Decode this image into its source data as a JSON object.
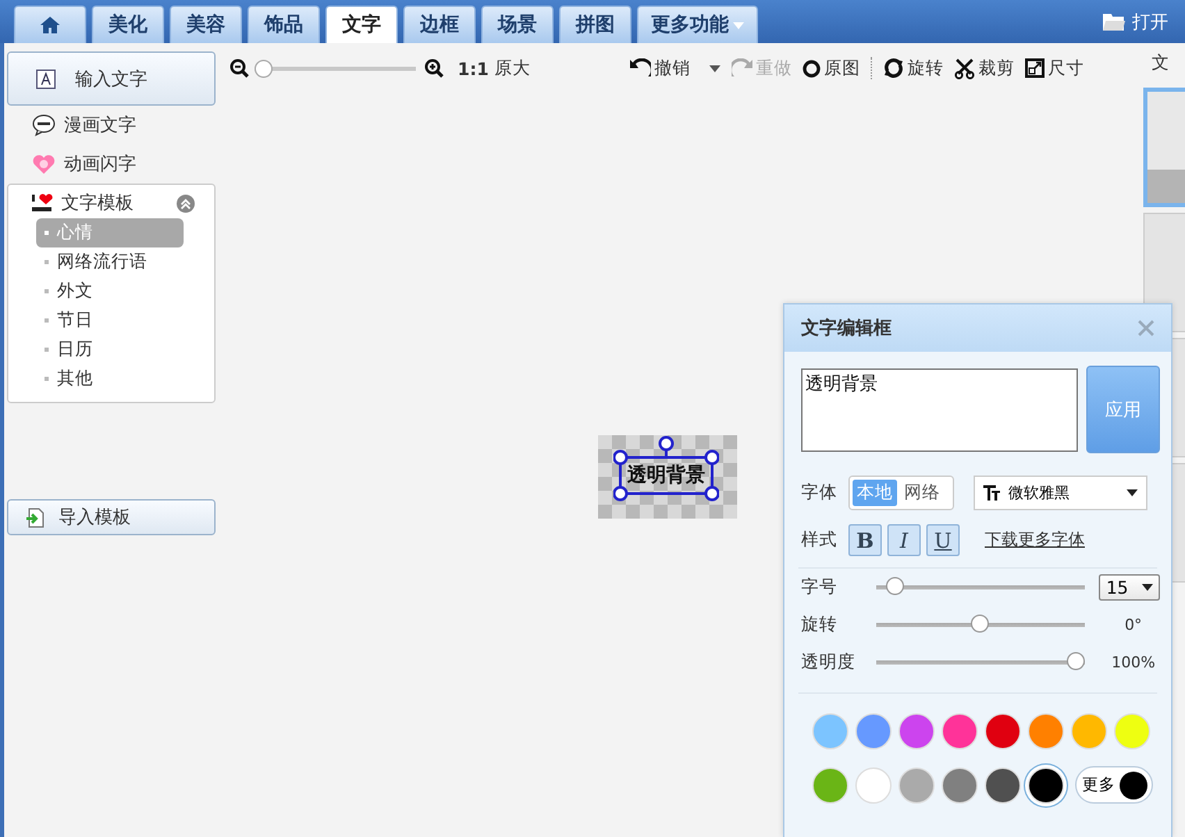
{
  "tabs": [
    {
      "kind": "home",
      "selected": false
    },
    {
      "kind": "tab",
      "label": "美化",
      "selected": false
    },
    {
      "kind": "tab",
      "label": "美容",
      "selected": false
    },
    {
      "kind": "tab",
      "label": "饰品",
      "selected": false
    },
    {
      "kind": "tab",
      "label": "文字",
      "selected": true
    },
    {
      "kind": "tab",
      "label": "边框",
      "selected": false
    },
    {
      "kind": "tab",
      "label": "场景",
      "selected": false
    },
    {
      "kind": "tab",
      "label": "拼图",
      "selected": false
    },
    {
      "kind": "menu",
      "label": "更多功能",
      "selected": false
    }
  ],
  "open_button": "打开",
  "sidebar": {
    "input_button": "输入文字",
    "items": [
      {
        "kind": "comic",
        "label": "漫画文字"
      },
      {
        "kind": "flash",
        "label": "动画闪字"
      }
    ],
    "template_section": {
      "title": "文字模板",
      "expanded": true,
      "items": [
        {
          "label": "心情",
          "selected": true
        },
        {
          "label": "网络流行语",
          "selected": false
        },
        {
          "label": "外文",
          "selected": false
        },
        {
          "label": "节日",
          "selected": false
        },
        {
          "label": "日历",
          "selected": false
        },
        {
          "label": "其他",
          "selected": false
        }
      ]
    },
    "import_button": "导入模板"
  },
  "toolbar": {
    "zoom": {
      "level": 0
    },
    "actual_size": "1:1",
    "actual_size_label": "原大",
    "actions": [
      {
        "kind": "undo",
        "label": "撤销",
        "disabled": false
      },
      {
        "kind": "redo",
        "label": "重做",
        "disabled": true
      },
      {
        "kind": "original",
        "label": "原图",
        "disabled": false
      },
      {
        "kind": "rotate",
        "label": "旋转",
        "disabled": false
      },
      {
        "kind": "crop",
        "label": "裁剪",
        "disabled": false
      },
      {
        "kind": "resize",
        "label": "尺寸",
        "disabled": false
      }
    ]
  },
  "canvas": {
    "text_object": "透明背景"
  },
  "right_panel": {
    "title": "文",
    "previews": [
      {
        "selected": true
      },
      {
        "selected": false
      },
      {
        "selected": false
      },
      {
        "selected": false
      }
    ]
  },
  "dialog": {
    "title": "文字编辑框",
    "text": "透明背景",
    "apply_button": "应用",
    "font_label": "字体",
    "font_sources": [
      {
        "label": "本地",
        "selected": true
      },
      {
        "label": "网络",
        "selected": false
      }
    ],
    "font_name": "微软雅黑",
    "style_label": "样式",
    "styles": [
      {
        "kind": "bold",
        "label": "B"
      },
      {
        "kind": "italic",
        "label": "I"
      },
      {
        "kind": "underline",
        "label": "U"
      }
    ],
    "download_link": "下载更多字体",
    "sliders": [
      {
        "label": "字号",
        "level": 0.05,
        "kind": "select",
        "value": "15"
      },
      {
        "label": "旋转",
        "level": 0.5,
        "kind": "reading",
        "reading": "0°"
      },
      {
        "label": "透明度",
        "level": 1,
        "kind": "reading",
        "reading": "100%"
      }
    ],
    "colors": [
      {
        "color": "#7cc4ff",
        "selected": false
      },
      {
        "color": "#6699ff",
        "selected": false
      },
      {
        "color": "#cc44ee",
        "selected": false
      },
      {
        "color": "#ff3399",
        "selected": false
      },
      {
        "color": "#e00010",
        "selected": false
      },
      {
        "color": "#ff8000",
        "selected": false
      },
      {
        "color": "#ffb800",
        "selected": false
      },
      {
        "color": "#eeff11",
        "selected": false
      },
      {
        "color": "#6ab516",
        "selected": false
      },
      {
        "color": "#ffffff",
        "selected": false
      },
      {
        "color": "#aaaaaa",
        "selected": false
      },
      {
        "color": "#808080",
        "selected": false
      },
      {
        "color": "#505050",
        "selected": false
      },
      {
        "color": "#000000",
        "selected": true
      }
    ],
    "more_button": {
      "label": "更多",
      "color": "#000000"
    }
  }
}
